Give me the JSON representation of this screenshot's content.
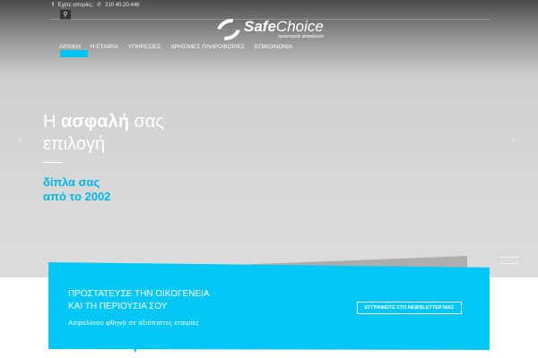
{
  "topbar": {
    "question": "Έχετε απορίες;",
    "phone": "210 40.20.446"
  },
  "logo": {
    "name_bold": "Safe",
    "name_light": "Choice",
    "tagline": "πρακτορείο ασφαλειών"
  },
  "nav": [
    {
      "label": "ΑΡΧΙΚΗ",
      "active": true
    },
    {
      "label": "Η ΕΤΑΙΡΙΑ"
    },
    {
      "label": "ΥΠΗΡΕΣΙΕΣ"
    },
    {
      "label": "ΧΡΗΣΙΜΕΣ ΠΛΗΡΟΦΟΡΙΕΣ"
    },
    {
      "label": "ΕΠΙΚΟΙΝΩΝΙΑ"
    }
  ],
  "hero": {
    "line1a": "Η ",
    "line1b": "ασφαλή",
    "line1c": " σας",
    "line2": "επιλογή",
    "sub1": "δίπλα σας",
    "sub2": "από το 2002"
  },
  "cta": {
    "title1": "ΠΡΟΣΤΑΤΕΥΣΕ ΤΗΝ ΟΙΚΟΓΕΝΕΙΑ",
    "title2": "ΚΑΙ ΤΗ ΠΕΡΙΟΥΣΙΑ ΣΟΥ",
    "subtitle": "Ασφαλίσου φθηνά σε αξιόπιστες εταιρίες",
    "button": "ΕΓΓΡΑΦΕΙΤΕ ΣΤΟ NEWSLETTER ΜΑΣ"
  },
  "colors": {
    "accent": "#00c7f7"
  }
}
